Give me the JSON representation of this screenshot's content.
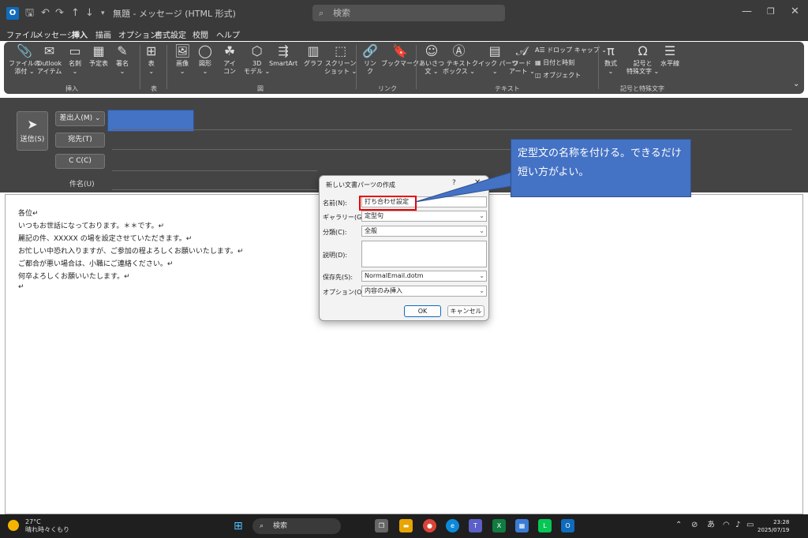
{
  "titlebar": {
    "logo_letter": "O",
    "title": "無題 - メッセージ (HTML 形式)",
    "search_placeholder": "検索",
    "icons": [
      "save-icon",
      "undo-icon",
      "redo-icon",
      "up-icon",
      "down-icon",
      "customize-icon"
    ]
  },
  "menu": [
    "ファイル",
    "メッセージ",
    "挿入",
    "描画",
    "オプション",
    "書式設定",
    "校閲",
    "ヘルプ"
  ],
  "menu_active": "挿入",
  "ribbon": {
    "groups": {
      "insert": "挿入",
      "table": "表",
      "figures": "図",
      "links": "リンク",
      "text": "テキスト",
      "symbols": "記号と特殊文字"
    },
    "buttons": {
      "attach": [
        "ファイルの",
        "添付 ⌄"
      ],
      "outlook_item": [
        "Outlook",
        "アイテム"
      ],
      "business_card": [
        "名刺",
        "⌄"
      ],
      "calendar": [
        "予定表",
        ""
      ],
      "signature": [
        "署名",
        "⌄"
      ],
      "table": [
        "表",
        "⌄"
      ],
      "pictures": [
        "画像",
        "⌄"
      ],
      "shapes": [
        "図形",
        "⌄"
      ],
      "icons": [
        "アイ",
        "コン"
      ],
      "models3d": [
        "3D",
        "モデル ⌄"
      ],
      "smartart": [
        "SmartArt",
        ""
      ],
      "chart": [
        "グラフ",
        ""
      ],
      "screenshot": [
        "スクリーン",
        "ショット ⌄"
      ],
      "link": [
        "リン",
        "ク"
      ],
      "bookmark": [
        "ブックマーク",
        ""
      ],
      "greeting": [
        "あいさつ",
        "文 ⌄"
      ],
      "textbox": [
        "テキスト",
        "ボックス ⌄"
      ],
      "quickparts": [
        "クイック パーツ",
        "⌄"
      ],
      "wordart": [
        "ワード",
        "アート ⌄"
      ],
      "equation": [
        "数式",
        "⌄"
      ],
      "symbol": [
        "記号と",
        "特殊文字 ⌄"
      ],
      "horizontal_line": [
        "水平線",
        ""
      ]
    },
    "small_buttons": {
      "dropcap": "ドロップ キャップ ⌄",
      "datetime": "日付と時刻",
      "object": "オブジェクト"
    }
  },
  "compose": {
    "send": "送信(S)",
    "from": "差出人(M) ⌄",
    "to": "宛先(T)",
    "cc": "C C(C)",
    "subject": "件名(U)"
  },
  "body_lines": [
    "各位↵",
    "いつもお世話になっております。＊＊です。↵",
    "麗記の件、XXXXX の場を設定させていただきます。↵",
    "お忙しい中恐れ入りますが、ご参加の程よろしくお願いいたします。↵",
    "ご都合が悪い場合は、小職にご連絡ください。↵",
    "何卒よろしくお願いいたします。↵",
    "↵"
  ],
  "callout": "定型文の名称を付ける。できるだけ短い方がよい。",
  "dialog": {
    "title": "新しい文書パーツの作成",
    "help": "?",
    "close": "✕",
    "fields": {
      "name": {
        "label": "名前(N):",
        "value": "打ち合わせ設定"
      },
      "gallery": {
        "label": "ギャラリー(G):",
        "value": "定型句"
      },
      "category": {
        "label": "分類(C):",
        "value": "全般"
      },
      "description": {
        "label": "説明(D):",
        "value": ""
      },
      "save_in": {
        "label": "保存先(S):",
        "value": "NormalEmail.dotm"
      },
      "options": {
        "label": "オプション(O):",
        "value": "内容のみ挿入"
      }
    },
    "ok": "OK",
    "cancel": "キャンセル"
  },
  "taskbar": {
    "temperature": "27°C",
    "weather": "晴れ時々くもり",
    "search": "検索",
    "tray": "あ",
    "time": "23:28",
    "date": "2025/07/19"
  },
  "colors": {
    "accent": "#4472c4",
    "highlight": "#ee0000",
    "title_bg": "#3a3a3a"
  }
}
